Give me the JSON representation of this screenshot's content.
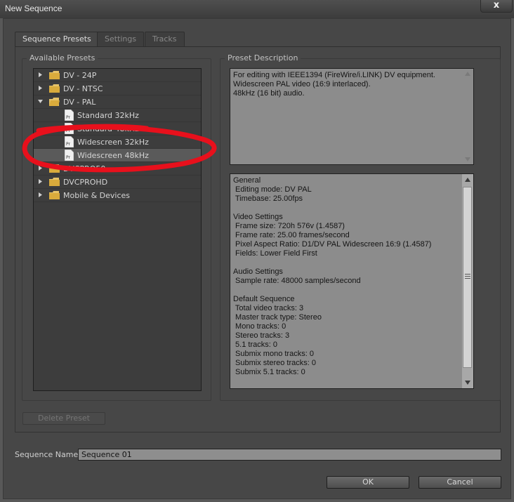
{
  "window": {
    "title": "New Sequence",
    "close_glyph": "x"
  },
  "tabs": [
    {
      "label": "Sequence Presets",
      "active": true
    },
    {
      "label": "Settings",
      "active": false
    },
    {
      "label": "Tracks",
      "active": false
    }
  ],
  "presets": {
    "label": "Available Presets",
    "items": [
      {
        "label": "DV - 24P",
        "type": "folder",
        "expanded": false
      },
      {
        "label": "DV - NTSC",
        "type": "folder",
        "expanded": false
      },
      {
        "label": "DV - PAL",
        "type": "folder",
        "expanded": true
      },
      {
        "label": "Standard 32kHz",
        "type": "preset"
      },
      {
        "label": "Standard 48kHz",
        "type": "preset"
      },
      {
        "label": "Widescreen 32kHz",
        "type": "preset"
      },
      {
        "label": "Widescreen 48kHz",
        "type": "preset",
        "selected": true
      },
      {
        "label": "DVCPRO50",
        "type": "folder",
        "expanded": false
      },
      {
        "label": "DVCPROHD",
        "type": "folder",
        "expanded": false
      },
      {
        "label": "Mobile & Devices",
        "type": "folder",
        "expanded": false
      }
    ],
    "file_badge": "Pr",
    "annotation_color": "#e8101c"
  },
  "description": {
    "label": "Preset Description",
    "summary": "For editing with IEEE1394 (FireWire/i.LINK) DV equipment.\nWidescreen PAL video (16:9 interlaced).\n48kHz (16 bit) audio.",
    "details": "General\n Editing mode: DV PAL\n Timebase: 25.00fps\n\nVideo Settings\n Frame size: 720h 576v (1.4587)\n Frame rate: 25.00 frames/second\n Pixel Aspect Ratio: D1/DV PAL Widescreen 16:9 (1.4587)\n Fields: Lower Field First\n\nAudio Settings\n Sample rate: 48000 samples/second\n\nDefault Sequence\n Total video tracks: 3\n Master track type: Stereo\n Mono tracks: 0\n Stereo tracks: 3\n 5.1 tracks: 0\n Submix mono tracks: 0\n Submix stereo tracks: 0\n Submix 5.1 tracks: 0"
  },
  "delete_button": "Delete Preset",
  "sequence_name": {
    "label": "Sequence Name:",
    "value": "Sequence 01"
  },
  "ok_button": "OK",
  "cancel_button": "Cancel"
}
